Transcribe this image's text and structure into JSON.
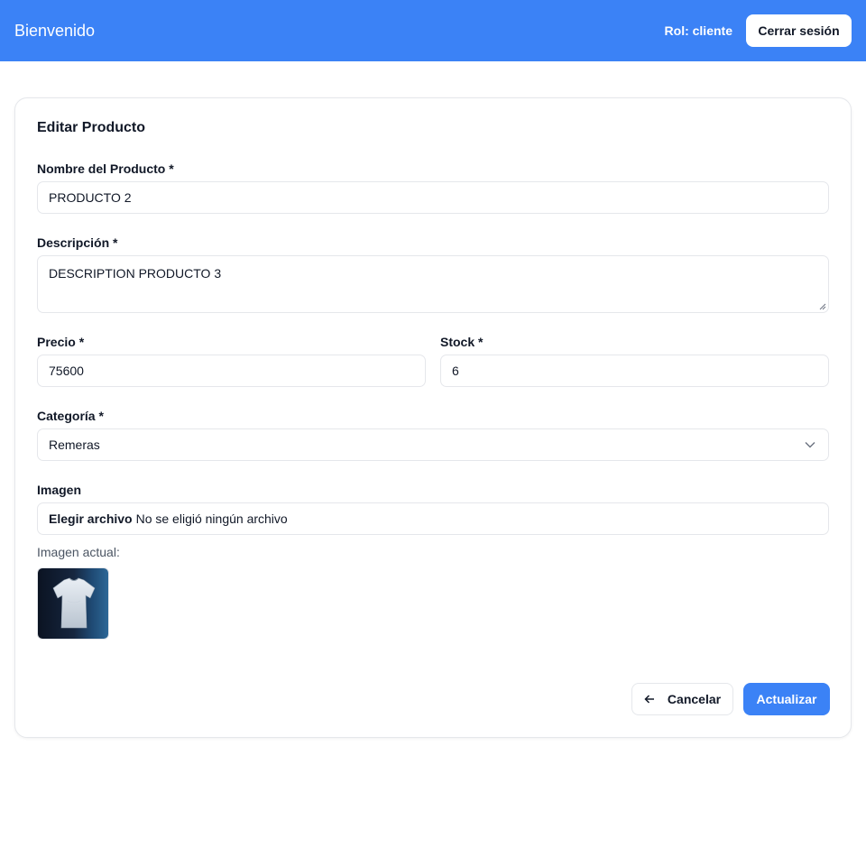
{
  "header": {
    "brand": "Bienvenido",
    "role": "Rol: cliente",
    "logout_label": "Cerrar sesión",
    "background_color": "#3b82f6"
  },
  "form": {
    "title": "Editar Producto",
    "name": {
      "label": "Nombre del Producto *",
      "value": "PRODUCTO 2"
    },
    "description": {
      "label": "Descripción *",
      "value": "DESCRIPTION PRODUCTO 3"
    },
    "price": {
      "label": "Precio *",
      "value": "75600"
    },
    "stock": {
      "label": "Stock *",
      "value": "6"
    },
    "category": {
      "label": "Categoría *",
      "value": "Remeras",
      "icon": "chevron-down-icon"
    },
    "image": {
      "label": "Imagen",
      "choose_label": "Elegir archivo",
      "no_file_text": "No se eligió ningún archivo",
      "current_label": "Imagen actual:",
      "current_image": "tshirt-product-image"
    },
    "cancel_label": "Cancelar",
    "cancel_icon": "arrow-left-icon",
    "submit_label": "Actualizar",
    "accent_color": "#3b82f6"
  }
}
